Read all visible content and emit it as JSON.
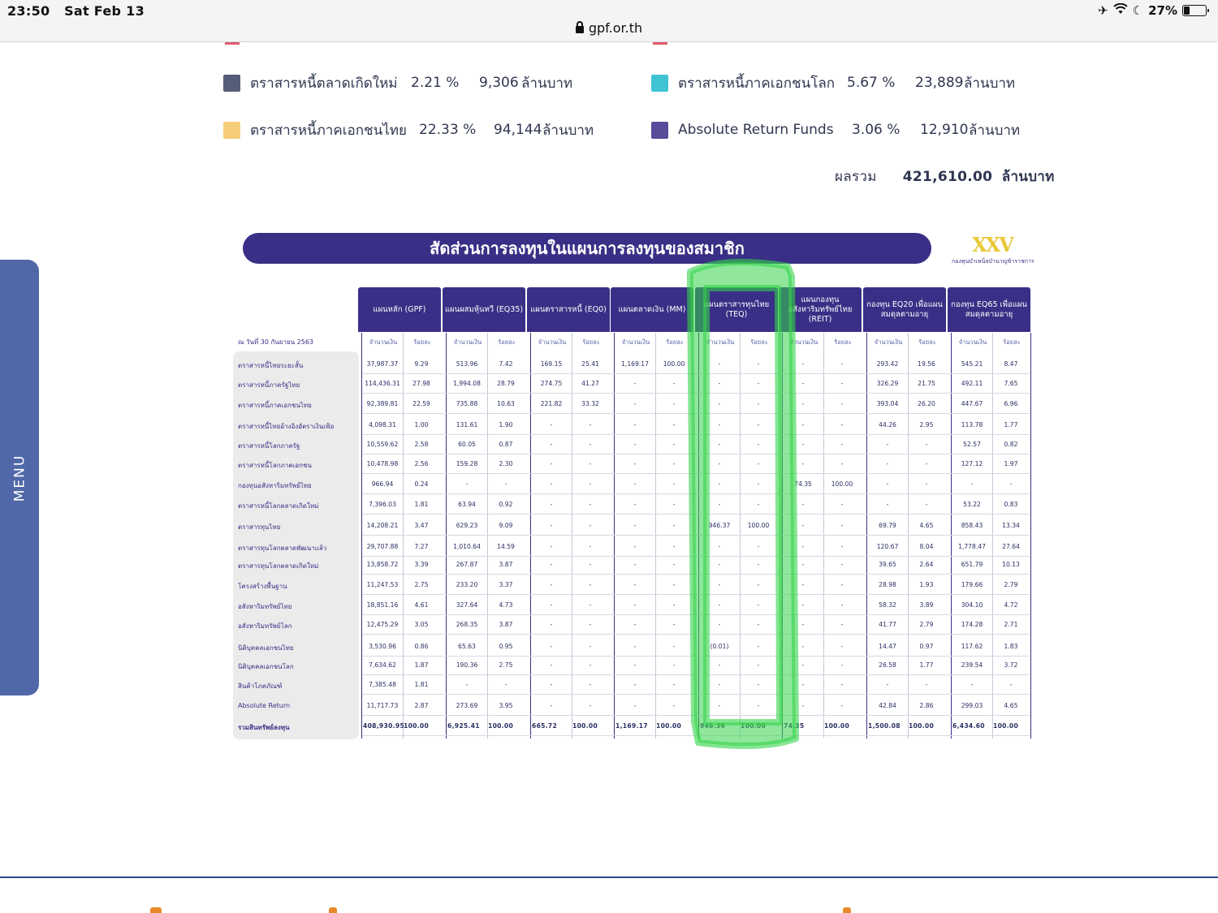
{
  "status_bar": {
    "time": "23:50",
    "date": "Sat Feb 13",
    "battery": "27%",
    "battery_level": 0.27
  },
  "browser": {
    "url": "gpf.or.th"
  },
  "legend": [
    {
      "label": "ตราสารหนี้ตลาดเกิดใหม่",
      "percent": "2.21 %",
      "amount": "9,306",
      "unit": "ล้านบาท",
      "color": "#565d78"
    },
    {
      "label": "ตราสารหนี้ภาคเอกชนโลก",
      "percent": "5.67 %",
      "amount": "23,889",
      "unit": "ล้านบาท",
      "color": "#3fc3d2"
    },
    {
      "label": "ตราสารหนี้ภาคเอกชนไทย",
      "percent": "22.33 %",
      "amount": "94,144",
      "unit": "ล้านบาท",
      "color": "#f6cd79"
    },
    {
      "label": "Absolute Return Funds",
      "percent": "3.06 %",
      "amount": "12,910",
      "unit": "ล้านบาท",
      "color": "#5a4a9a"
    }
  ],
  "total": {
    "label": "ผลรวม",
    "amount": "421,610.00",
    "unit": "ล้านบาท"
  },
  "menu": {
    "label": "MENU"
  },
  "table": {
    "title": "สัดส่วนการลงทุนในแผนการลงทุนของสมาชิก",
    "logo_mark": "XXV",
    "logo_sub": "กองทุนบำเหน็จบำนาญข้าราชการ",
    "as_of": "ณ วันที่ 30 กันยายน 2563",
    "col_amount": "จำนวนเงิน",
    "col_percent": "ร้อยละ",
    "plans": [
      {
        "name": "แผนหลัก (GPF)"
      },
      {
        "name": "แผนผสมหุ้นทวี (EQ35)"
      },
      {
        "name": "แผนตราสารหนี้ (EQ0)"
      },
      {
        "name": "แผนตลาดเงิน (MM)"
      },
      {
        "name": "แผนตราสารทุนไทย (TEQ)"
      },
      {
        "name": "แผนกองทุน อสังหาริมทรัพย์ไทย (REIT)"
      },
      {
        "name": "กองทุน EQ20 เพื่อแผนสมดุลตามอายุ"
      },
      {
        "name": "กองทุน EQ65 เพื่อแผนสมดุลตามอายุ"
      }
    ],
    "rows": [
      {
        "label": "ตราสารหนี้ไทยระยะสั้น",
        "cells": [
          "37,987.37",
          "9.29",
          "513.96",
          "7.42",
          "169.15",
          "25.41",
          "1,169.17",
          "100.00",
          "-",
          "-",
          "-",
          "-",
          "293.42",
          "19.56",
          "545.21",
          "8.47"
        ]
      },
      {
        "label": "ตราสารหนี้ภาครัฐไทย",
        "cells": [
          "114,436.31",
          "27.98",
          "1,994.08",
          "28.79",
          "274.75",
          "41.27",
          "-",
          "-",
          "-",
          "-",
          "-",
          "-",
          "326.29",
          "21.75",
          "492.11",
          "7.65"
        ]
      },
      {
        "label": "ตราสารหนี้ภาคเอกชนไทย",
        "cells": [
          "92,389.81",
          "22.59",
          "735.88",
          "10.63",
          "221.82",
          "33.32",
          "-",
          "-",
          "-",
          "-",
          "-",
          "-",
          "393.04",
          "26.20",
          "447.67",
          "6.96"
        ]
      },
      {
        "label": "ตราสารหนี้ไทยอ้างอิงอัตราเงินเฟ้อ",
        "cells": [
          "4,098.31",
          "1.00",
          "131.61",
          "1.90",
          "-",
          "-",
          "-",
          "-",
          "-",
          "-",
          "-",
          "-",
          "44.26",
          "2.95",
          "113.78",
          "1.77"
        ]
      },
      {
        "label": "ตราสารหนี้โลกภาครัฐ",
        "cells": [
          "10,559.62",
          "2.58",
          "60.05",
          "0.87",
          "-",
          "-",
          "-",
          "-",
          "-",
          "-",
          "-",
          "-",
          "-",
          "-",
          "52.57",
          "0.82"
        ]
      },
      {
        "label": "ตราสารหนี้โลกภาคเอกชน",
        "cells": [
          "10,478.98",
          "2.56",
          "159.28",
          "2.30",
          "-",
          "-",
          "-",
          "-",
          "-",
          "-",
          "-",
          "-",
          "-",
          "-",
          "127.12",
          "1.97"
        ]
      },
      {
        "label": "กองทุนอสังหาริมทรัพย์ไทย",
        "cells": [
          "966.94",
          "0.24",
          "-",
          "-",
          "-",
          "-",
          "-",
          "-",
          "-",
          "-",
          "74.35",
          "100.00",
          "-",
          "-",
          "-",
          "-"
        ]
      },
      {
        "label": "ตราสารหนี้โลกตลาดเกิดใหม่",
        "cells": [
          "7,396.03",
          "1.81",
          "63.94",
          "0.92",
          "-",
          "-",
          "-",
          "-",
          "-",
          "-",
          "-",
          "-",
          "-",
          "-",
          "53.22",
          "0.83"
        ]
      },
      {
        "label": "ตราสารทุนไทย",
        "cells": [
          "14,208.21",
          "3.47",
          "629.23",
          "9.09",
          "-",
          "-",
          "-",
          "-",
          "946.37",
          "100.00",
          "-",
          "-",
          "69.79",
          "4.65",
          "858.43",
          "13.34"
        ]
      },
      {
        "label": "ตราสารทุนโลกตลาดพัฒนาแล้ว",
        "cells": [
          "29,707.88",
          "7.27",
          "1,010.64",
          "14.59",
          "-",
          "-",
          "-",
          "-",
          "-",
          "-",
          "-",
          "-",
          "120.67",
          "8.04",
          "1,778.47",
          "27.64"
        ]
      },
      {
        "label": "ตราสารทุนโลกตลาดเกิดใหม่",
        "cells": [
          "13,858.72",
          "3.39",
          "267.87",
          "3.87",
          "-",
          "-",
          "-",
          "-",
          "-",
          "-",
          "-",
          "-",
          "39.65",
          "2.64",
          "651.79",
          "10.13"
        ]
      },
      {
        "label": "โครงสร้างพื้นฐาน",
        "cells": [
          "11,247.53",
          "2.75",
          "233.20",
          "3.37",
          "-",
          "-",
          "-",
          "-",
          "-",
          "-",
          "-",
          "-",
          "28.98",
          "1.93",
          "179.66",
          "2.79"
        ]
      },
      {
        "label": "อสังหาริมทรัพย์ไทย",
        "cells": [
          "18,851.16",
          "4.61",
          "327.64",
          "4.73",
          "-",
          "-",
          "-",
          "-",
          "-",
          "-",
          "-",
          "-",
          "58.32",
          "3.89",
          "304.10",
          "4.72"
        ]
      },
      {
        "label": "อสังหาริมทรัพย์โลก",
        "cells": [
          "12,475.29",
          "3.05",
          "268.35",
          "3.87",
          "-",
          "-",
          "-",
          "-",
          "-",
          "-",
          "-",
          "-",
          "41.77",
          "2.79",
          "174.28",
          "2.71"
        ]
      },
      {
        "label": "นิติบุคคลเอกชนไทย",
        "cells": [
          "3,530.96",
          "0.86",
          "65.63",
          "0.95",
          "-",
          "-",
          "-",
          "-",
          "(0.01)",
          "-",
          "-",
          "-",
          "14.47",
          "0.97",
          "117.62",
          "1.83"
        ]
      },
      {
        "label": "นิติบุคคลเอกชนโลก",
        "cells": [
          "7,634.62",
          "1.87",
          "190.36",
          "2.75",
          "-",
          "-",
          "-",
          "-",
          "-",
          "-",
          "-",
          "-",
          "26.58",
          "1.77",
          "239.54",
          "3.72"
        ]
      },
      {
        "label": "สินค้าโภคภัณฑ์",
        "cells": [
          "7,385.48",
          "1.81",
          "-",
          "-",
          "-",
          "-",
          "-",
          "-",
          "-",
          "-",
          "-",
          "-",
          "-",
          "-",
          "-",
          "-"
        ]
      },
      {
        "label": "Absolute Return",
        "cells": [
          "11,717.73",
          "2.87",
          "273.69",
          "3.95",
          "-",
          "-",
          "-",
          "-",
          "-",
          "-",
          "-",
          "-",
          "42.84",
          "2.86",
          "299.03",
          "4.65"
        ]
      },
      {
        "label": "รวมสินทรัพย์ลงทุน",
        "cells": [
          "408,930.95",
          "100.00",
          "6,925.41",
          "100.00",
          "665.72",
          "100.00",
          "1,169.17",
          "100.00",
          "946.36",
          "100.00",
          "74.35",
          "100.00",
          "1,500.08",
          "100.00",
          "6,434.60",
          "100.00"
        ],
        "is_total": true
      }
    ]
  }
}
